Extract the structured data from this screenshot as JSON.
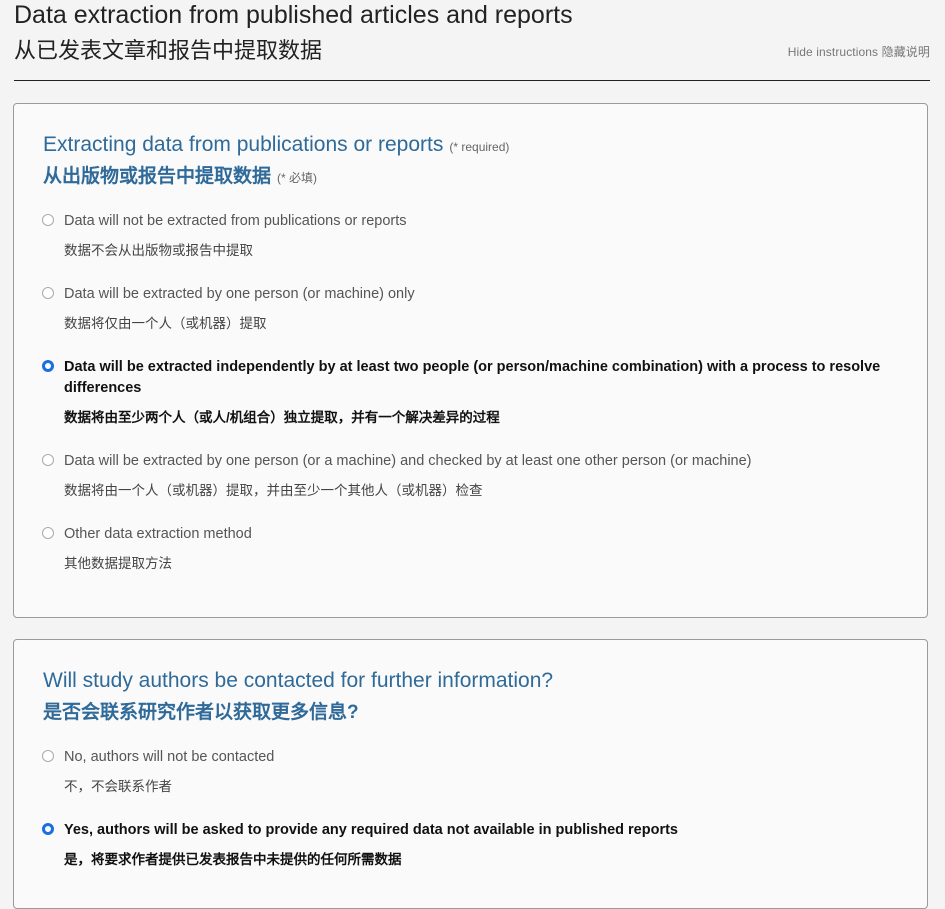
{
  "header": {
    "title_en": "Data extraction from published articles and reports",
    "title_zh": "从已发表文章和报告中提取数据",
    "hide_instructions": "Hide instructions  隐藏说明"
  },
  "q1": {
    "title_en": "Extracting data from publications or reports",
    "required_en": "(* required)",
    "title_zh": "从出版物或报告中提取数据",
    "required_zh": "(* 必填)",
    "selected_index": 2,
    "options": [
      {
        "en": "Data will not be extracted from publications or reports",
        "zh": "数据不会从出版物或报告中提取"
      },
      {
        "en": "Data will be extracted by one person (or machine) only",
        "zh": "数据将仅由一个人（或机器）提取"
      },
      {
        "en": "Data will be extracted independently by at least two people (or person/machine combination) with a process to resolve differences",
        "zh": "数据将由至少两个人（或人/机组合）独立提取，并有一个解决差异的过程"
      },
      {
        "en": "Data will be extracted by one person (or a machine) and checked by at least one other person (or machine)",
        "zh": "数据将由一个人（或机器）提取，并由至少一个其他人（或机器）检查"
      },
      {
        "en": "Other data extraction method",
        "zh": "其他数据提取方法"
      }
    ]
  },
  "q2": {
    "title_en": "Will study authors be contacted for further information?",
    "title_zh": "是否会联系研究作者以获取更多信息?",
    "selected_index": 1,
    "options": [
      {
        "en": "No, authors will not be contacted",
        "zh": "不，不会联系作者"
      },
      {
        "en": "Yes, authors will be asked to provide any required data not available in published reports",
        "zh": "是，将要求作者提供已发表报告中未提供的任何所需数据"
      }
    ]
  }
}
